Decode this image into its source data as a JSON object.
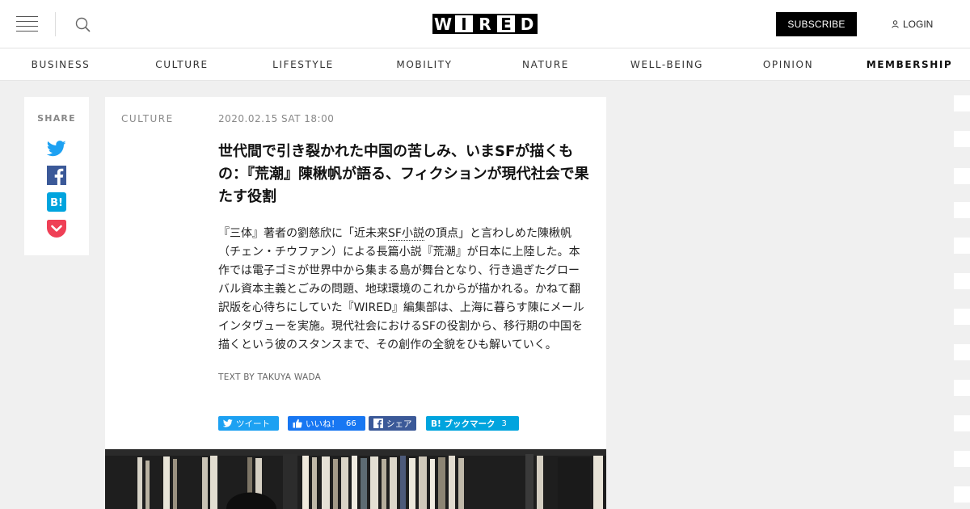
{
  "header": {
    "logo_letters": [
      "W",
      "I",
      "R",
      "E",
      "D"
    ],
    "subscribe_label": "SUBSCRIBE",
    "login_label": "LOGIN",
    "menu_icon": "hamburger-icon",
    "search_icon": "search-icon"
  },
  "nav": {
    "items": [
      {
        "label": "BUSINESS"
      },
      {
        "label": "CULTURE"
      },
      {
        "label": "LIFESTYLE"
      },
      {
        "label": "MOBILITY"
      },
      {
        "label": "NATURE"
      },
      {
        "label": "WELL-BEING"
      },
      {
        "label": "OPINION"
      },
      {
        "label": "MEMBERSHIP"
      }
    ]
  },
  "share": {
    "label": "SHARE",
    "icons": [
      "twitter-icon",
      "facebook-icon",
      "hatena-bookmark-icon",
      "pocket-icon"
    ]
  },
  "article": {
    "category": "CULTURE",
    "date": "2020.02.15 SAT 18:00",
    "title": "世代間で引き裂かれた中国の苦しみ、いまSFが描くもの：『荒潮』陳楸帆が語る、フィクションが現代社会で果たす役割",
    "lead_before": "『三体』著者の劉慈欣に「近未来",
    "lead_link": "SF小説",
    "lead_after": "の頂点」と言わしめた陳楸帆（チェン・チウファン）による長篇小説『荒潮』が日本に上陸した。本作では電子ゴミが世界中から集まる島が舞台となり、行き過ぎたグローバル資本主義とごみの問題、地球環境のこれからが描かれる。かねて翻訳版を心待ちにしていた『WIRED』編集部は、上海に暮らす陳にメールインタヴューを実施。現代社会におけるSFの役割から、移行期の中国を描くという彼のスタンスまで、その創作の全貌をひも解いていく。",
    "credit": "TEXT BY TAKUYA WADA"
  },
  "share_buttons": {
    "tweet": {
      "label": "ツイート",
      "color": "#1da1f2"
    },
    "like": {
      "label": "いいね！",
      "count": "66",
      "color": "#1877f2"
    },
    "fb_share": {
      "label": "シェア",
      "color": "#3b5998"
    },
    "hatena": {
      "label": "B! ブックマーク",
      "count": "3",
      "color": "#00a4de"
    }
  },
  "colors": {
    "background": "#f0f0f0",
    "twitter": "#1da1f2",
    "facebook": "#3b5998",
    "hatena": "#00a4de",
    "pocket": "#ef4056"
  }
}
